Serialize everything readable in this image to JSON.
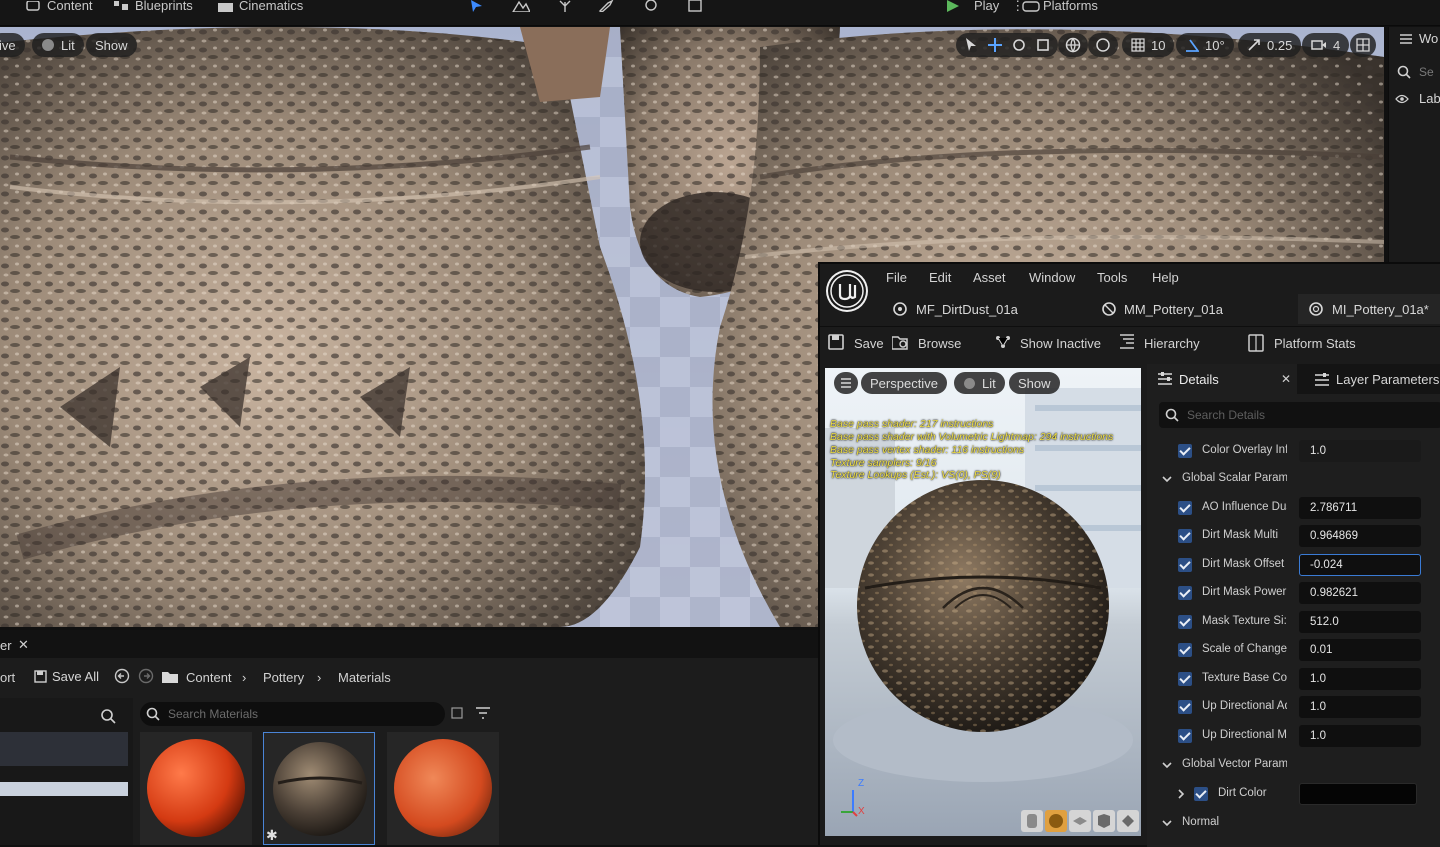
{
  "toolbar": {
    "content_label": "Content",
    "blueprints_label": "Blueprints",
    "cinematics_label": "Cinematics",
    "play_label": "Play",
    "platforms_label": "Platforms"
  },
  "viewport": {
    "mode_partial": "ive",
    "lit_label": "Lit",
    "show_label": "Show",
    "grid_snap": "10",
    "angle_snap": "10°",
    "scale_snap": "0.25",
    "camera_speed": "4"
  },
  "outliner": {
    "title_partial": "Wo",
    "search_partial": "Se",
    "label_partial": "Lab"
  },
  "content_browser": {
    "tab_partial": "er",
    "import_partial": "ort",
    "save_all_label": "Save All",
    "breadcrumb": [
      "Content",
      "Pottery",
      "Materials"
    ],
    "search_placeholder": "Search Materials"
  },
  "material_editor": {
    "menu": [
      "File",
      "Edit",
      "Asset",
      "Window",
      "Tools",
      "Help"
    ],
    "asset_tabs": [
      "MF_DirtDust_01a",
      "MM_Pottery_01a",
      "MI_Pottery_01a*"
    ],
    "tools": {
      "save": "Save",
      "browse": "Browse",
      "show_inactive": "Show Inactive",
      "hierarchy": "Hierarchy",
      "platform_stats": "Platform Stats"
    },
    "preview": {
      "perspective_label": "Perspective",
      "lit_label": "Lit",
      "show_label": "Show",
      "shader_stats": [
        "Base pass shader: 217 instructions",
        "Base pass shader with Volumetric Lightmap: 294 instructions",
        "Base pass vertex shader: 116 instructions",
        "Texture samplers: 9/16",
        "Texture Lookups (Est.): VS(0), PS(9)"
      ],
      "axis_z": "Z",
      "axis_x": "X"
    },
    "details": {
      "tab_label": "Details",
      "layer_tab_label": "Layer Parameters",
      "search_placeholder": "Search Details",
      "color_overlay": {
        "label": "Color Overlay Inf",
        "value": "1.0"
      },
      "global_scalar_label": "Global Scalar Parame",
      "scalar_params": [
        {
          "label": "AO Influence Dus",
          "value": "2.786711"
        },
        {
          "label": "Dirt Mask Multi",
          "value": "0.964869"
        },
        {
          "label": "Dirt Mask Offset",
          "value": "-0.024"
        },
        {
          "label": "Dirt Mask Power",
          "value": "0.982621"
        },
        {
          "label": "Mask Texture Si:",
          "value": "512.0"
        },
        {
          "label": "Scale of Change",
          "value": "0.01"
        },
        {
          "label": "Texture Base Co",
          "value": "1.0"
        },
        {
          "label": "Up Directional Ad",
          "value": "1.0"
        },
        {
          "label": "Up Directional Mi",
          "value": "1.0"
        }
      ],
      "global_vector_label": "Global Vector Parame",
      "dirt_color_label": "Dirt Color",
      "dirt_color_value": "#050505",
      "normal_label": "Normal"
    }
  },
  "colors": {
    "accent_blue": "#3a7bd5",
    "play_green": "#5cb85c",
    "checkbox_blue": "#2c4f86",
    "shader_text": "#f2e24a"
  }
}
